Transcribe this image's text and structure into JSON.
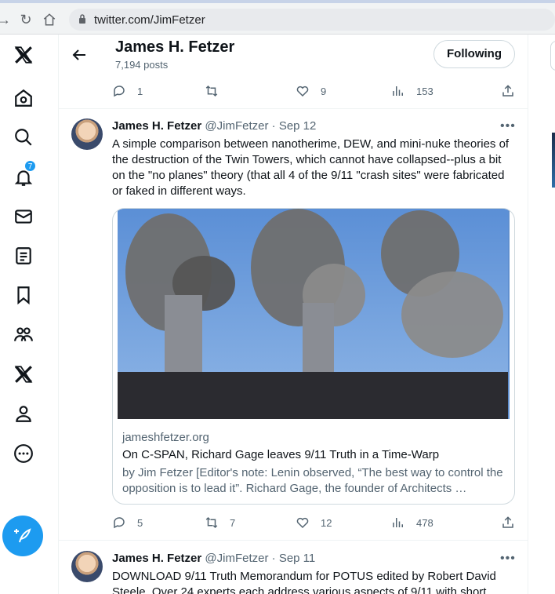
{
  "browser": {
    "url": "twitter.com/JimFetzer"
  },
  "nav": {
    "notification_count": "7"
  },
  "header": {
    "name": "James H. Fetzer",
    "post_count": "7,194 posts",
    "follow_label": "Following"
  },
  "prev_tweet": {
    "replies": "1",
    "retweets": "",
    "likes": "9",
    "views": "153"
  },
  "tweet1": {
    "name": "James H. Fetzer",
    "handle": "@JimFetzer",
    "sep": "·",
    "date": "Sep 12",
    "text": "A simple comparison between nanotherime, DEW, and mini-nuke theories of the destruction of the Twin Towers, which cannot have collapsed--plus a bit on the \"no planes\" theory (that all 4 of the 9/11 \"crash sites\" were fabricated or faked in different ways.",
    "card": {
      "domain": "jameshfetzer.org",
      "title": "On C-SPAN, Richard Gage leaves 9/11 Truth in a Time-Warp",
      "description": "by Jim Fetzer  [Editor's note: Lenin observed, “The best way to control the opposition is to lead it”. Richard Gage, the founder of Architects …"
    },
    "replies": "5",
    "retweets": "7",
    "likes": "12",
    "views": "478"
  },
  "tweet2": {
    "name": "James H. Fetzer",
    "handle": "@JimFetzer",
    "sep": "·",
    "date": "Sep 11",
    "text": "DOWNLOAD 9/11 Truth Memorandum for POTUS edited by Robert David Steele. Over 24 experts each address various aspects of 9/11 with short"
  },
  "colors": {
    "accent": "#1d9bf0",
    "muted": "#536471",
    "border": "#eff3f4"
  }
}
